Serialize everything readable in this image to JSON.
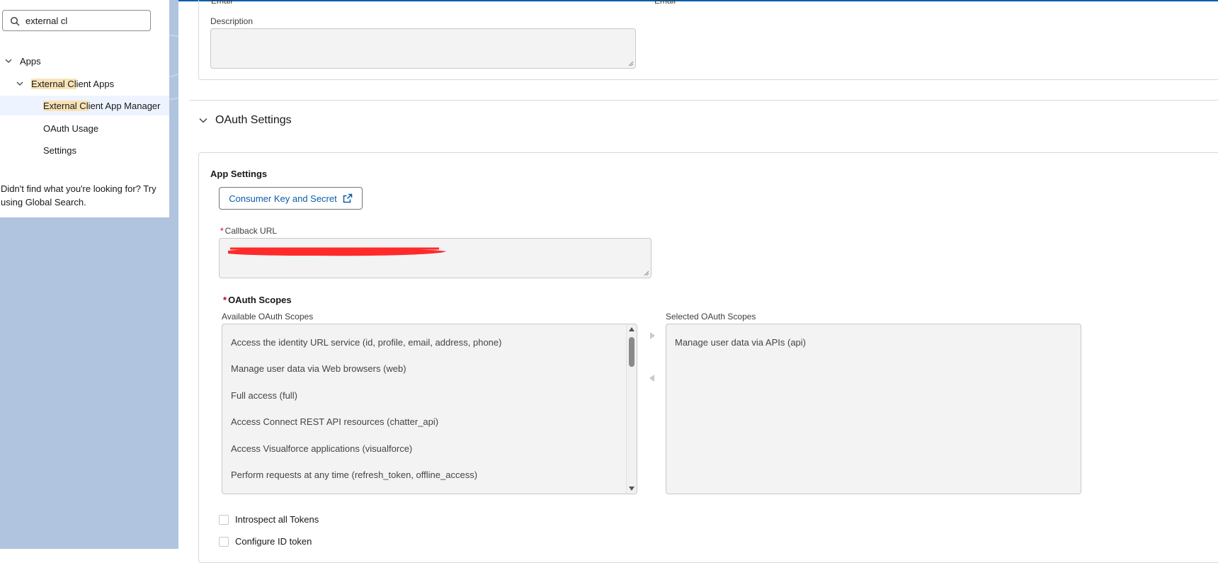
{
  "sidebar": {
    "search_value": "external cl",
    "tree": {
      "apps": {
        "label": "Apps"
      },
      "external_client_apps": {
        "hl": "External Cl",
        "rest": "ient Apps"
      },
      "manager": {
        "hl": "External Cl",
        "rest": "ient App Manager"
      },
      "oauth_usage": {
        "label": "OAuth Usage"
      },
      "settings": {
        "label": "Settings"
      }
    },
    "not_found": "Didn't find what you're looking for? Try using Global Search."
  },
  "main": {
    "cut_labels": [
      "Email",
      "Email"
    ],
    "description_label": "Description",
    "oauth_section_title": "OAuth Settings",
    "app_settings_label": "App Settings",
    "consumer_key_button": "Consumer Key and Secret",
    "callback_label": "Callback URL",
    "required_marker": "*",
    "oauth_scopes_label": "OAuth Scopes",
    "available_label": "Available OAuth Scopes",
    "selected_label": "Selected OAuth Scopes",
    "available_scopes": [
      "Access the identity URL service (id, profile, email, address, phone)",
      "Manage user data via Web browsers (web)",
      "Full access (full)",
      "Access Connect REST API resources (chatter_api)",
      "Access Visualforce applications (visualforce)",
      "Perform requests at any time (refresh_token, offline_access)"
    ],
    "selected_scopes": [
      "Manage user data via APIs (api)"
    ],
    "checkboxes": [
      "Introspect all Tokens",
      "Configure ID token"
    ]
  },
  "colors": {
    "accent": "#0b5cab",
    "required": "#ba0517",
    "highlight": "#f9e3b6",
    "nav_background": "#b0c4df",
    "redaction": "#ff2a2a"
  }
}
